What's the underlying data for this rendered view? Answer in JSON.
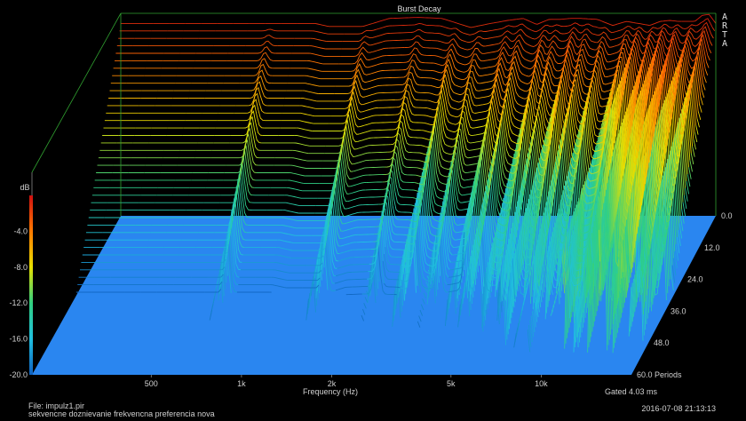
{
  "chart_data": {
    "type": "waterfall-3d",
    "title": "Burst Decay",
    "brand_letters": [
      "A",
      "R",
      "T",
      "A"
    ],
    "xlabel": "Frequency (Hz)",
    "x_scale": "log",
    "xlim": [
      200,
      20000
    ],
    "x_ticks": [
      {
        "value": 500,
        "label": "500"
      },
      {
        "value": 1000,
        "label": "1k"
      },
      {
        "value": 2000,
        "label": "2k"
      },
      {
        "value": 5000,
        "label": "5k"
      },
      {
        "value": 10000,
        "label": "10k"
      }
    ],
    "ylabel": "dB",
    "ylim": [
      -20,
      0
    ],
    "y_ticks": [
      "-4.0",
      "-8.0",
      "-12.0",
      "-16.0",
      "-20.0"
    ],
    "y_tick_values": [
      -4,
      -8,
      -12,
      -16,
      -20
    ],
    "z_label": "Periods",
    "zlim": [
      0,
      60
    ],
    "z_ticks": [
      "0.0",
      "12.0",
      "24.0",
      "36.0",
      "48.0",
      "60.0"
    ],
    "z_tick_values": [
      0,
      12,
      24,
      36,
      48,
      60
    ],
    "footer_right": "Gated 4.03 ms",
    "front_response": {
      "freq": [
        200,
        400,
        700,
        900,
        1000,
        1100,
        1300,
        1600,
        2000,
        2400,
        3000,
        3500,
        4000,
        4500,
        5000,
        5500,
        6000,
        6500,
        7000,
        8000,
        9000,
        10000,
        11000,
        12000,
        13000,
        14000,
        15000,
        16000,
        17000,
        18000,
        19000,
        20000
      ],
      "db": [
        -1.0,
        -1.0,
        -1.0,
        -1.0,
        -1.3,
        -1.3,
        -1.3,
        -0.5,
        -0.4,
        -0.5,
        -1.4,
        -1.0,
        -0.7,
        -0.5,
        -1.1,
        -0.6,
        -0.6,
        -0.5,
        -0.5,
        -0.6,
        -1.2,
        -0.8,
        -1.0,
        -1.2,
        -0.8,
        -0.7,
        -0.8,
        -0.8,
        -0.8,
        -0.2,
        -0.1,
        -1.0
      ]
    },
    "colorscale_db": [
      0,
      -4,
      -8,
      -12,
      -16,
      -20
    ],
    "colorscale_colors": [
      "#d01010",
      "#ff7a00",
      "#e8e000",
      "#30d080",
      "#20c0e0",
      "#1060c0"
    ],
    "floor_color": "#2a86f0"
  },
  "footer": {
    "file": "File: impulz1.pir",
    "description": "sekvencne doznievanie frekvencna  preferencia nova",
    "timestamp": "2016-07-08  21:13:13"
  }
}
